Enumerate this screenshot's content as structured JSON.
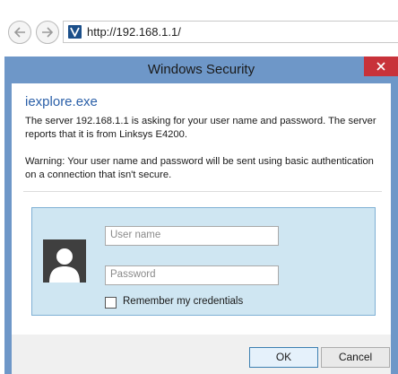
{
  "browser": {
    "url": "http://192.168.1.1/",
    "back_icon": "back-arrow-icon",
    "forward_icon": "forward-arrow-icon",
    "favicon": "site-favicon-icon"
  },
  "dialog": {
    "title": "Windows Security",
    "close_icon": "close-icon",
    "app_name": "iexplore.exe",
    "message": "The server 192.168.1.1 is asking for your user name and password. The server reports that it is from Linksys E4200.",
    "warning": "Warning: Your user name and password will be sent using basic authentication on a connection that isn't secure.",
    "username_placeholder": "User name",
    "password_placeholder": "Password",
    "remember_label": "Remember my credentials",
    "ok_label": "OK",
    "cancel_label": "Cancel"
  },
  "colors": {
    "frame": "#6e97c8",
    "close": "#c8323a",
    "app_name": "#2a5fa8",
    "panel": "#cfe6f2"
  }
}
